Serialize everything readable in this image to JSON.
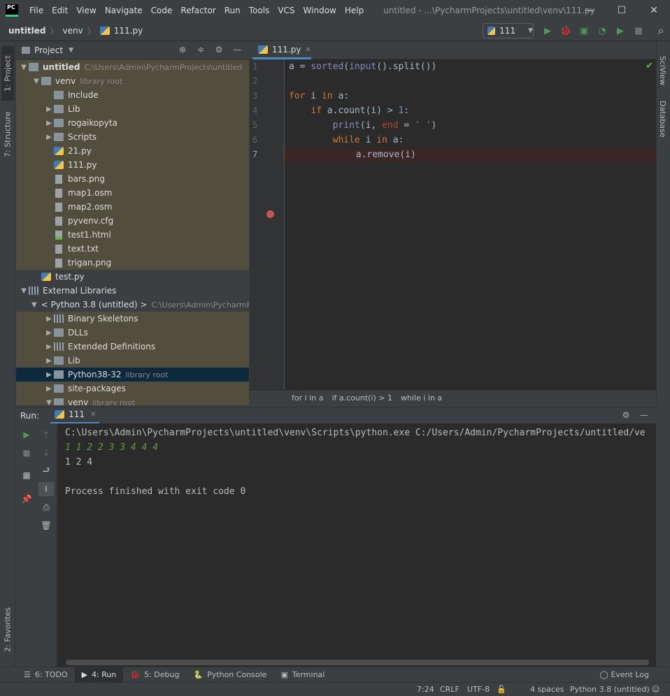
{
  "titlebar": {
    "logo": "PC",
    "menu": [
      "File",
      "Edit",
      "View",
      "Navigate",
      "Code",
      "Refactor",
      "Run",
      "Tools",
      "VCS",
      "Window",
      "Help"
    ],
    "window_title": "untitled - ...\\PycharmProjects\\untitled\\venv\\111.py",
    "minimize": "—",
    "maximize": "☐",
    "close": "✕"
  },
  "navbar": {
    "crumbs": [
      "untitled",
      "venv",
      "111.py"
    ],
    "run_config": "111",
    "tools": {
      "run": "▶",
      "debug": "🐞",
      "coverage": "▣",
      "profile": "◔",
      "concurrency": "▶",
      "stop": "■",
      "search": "⌕"
    }
  },
  "left_strip": {
    "project_tab": "1: Project",
    "structure_tab": "7: Structure",
    "favorites_tab": "2: Favorites"
  },
  "right_strip": {
    "sciview_tab": "SciView",
    "database_tab": "Database"
  },
  "project": {
    "header": "Project",
    "tree": [
      {
        "label": "untitled",
        "path": "C:\\Users\\Admin\\PycharmProjects\\untitled",
        "indent": 0,
        "arrow": "▼",
        "icon": "folder",
        "bold": true,
        "bg": "lib"
      },
      {
        "label": "venv",
        "path": "library root",
        "indent": 1,
        "arrow": "▼",
        "icon": "folder",
        "bg": "lib"
      },
      {
        "label": "Include",
        "indent": 2,
        "arrow": "",
        "icon": "folder",
        "bg": "lib"
      },
      {
        "label": "Lib",
        "indent": 2,
        "arrow": "▶",
        "icon": "folder",
        "bg": "lib"
      },
      {
        "label": "rogaikopyta",
        "indent": 2,
        "arrow": "▶",
        "icon": "folder",
        "bg": "lib"
      },
      {
        "label": "Scripts",
        "indent": 2,
        "arrow": "▶",
        "icon": "folder",
        "bg": "lib"
      },
      {
        "label": "21.py",
        "indent": 2,
        "arrow": "",
        "icon": "py",
        "bg": "lib"
      },
      {
        "label": "111.py",
        "indent": 2,
        "arrow": "",
        "icon": "py",
        "bg": "lib"
      },
      {
        "label": "bars.png",
        "indent": 2,
        "arrow": "",
        "icon": "img",
        "bg": "lib"
      },
      {
        "label": "map1.osm",
        "indent": 2,
        "arrow": "",
        "icon": "file",
        "bg": "lib"
      },
      {
        "label": "map2.osm",
        "indent": 2,
        "arrow": "",
        "icon": "file",
        "bg": "lib"
      },
      {
        "label": "pyvenv.cfg",
        "indent": 2,
        "arrow": "",
        "icon": "file",
        "bg": "lib"
      },
      {
        "label": "test1.html",
        "indent": 2,
        "arrow": "",
        "icon": "html",
        "bg": "lib"
      },
      {
        "label": "text.txt",
        "indent": 2,
        "arrow": "",
        "icon": "file",
        "bg": "lib"
      },
      {
        "label": "trigan.png",
        "indent": 2,
        "arrow": "",
        "icon": "img",
        "bg": "lib"
      },
      {
        "label": "test.py",
        "indent": 1,
        "arrow": "",
        "icon": "py",
        "bg": ""
      },
      {
        "label": "External Libraries",
        "indent": 0,
        "arrow": "▼",
        "icon": "lib",
        "bg": ""
      },
      {
        "label": "< Python 3.8 (untitled) >",
        "path": "C:\\Users\\Admin\\PycharmPr",
        "indent": 1,
        "arrow": "▼",
        "icon": "py",
        "bg": ""
      },
      {
        "label": "Binary Skeletons",
        "indent": 2,
        "arrow": "▶",
        "icon": "lib",
        "bg": "lib"
      },
      {
        "label": "DLLs",
        "indent": 2,
        "arrow": "▶",
        "icon": "folder",
        "bg": "lib"
      },
      {
        "label": "Extended Definitions",
        "indent": 2,
        "arrow": "▶",
        "icon": "lib",
        "bg": "lib"
      },
      {
        "label": "Lib",
        "indent": 2,
        "arrow": "▶",
        "icon": "folder",
        "bg": "lib"
      },
      {
        "label": "Python38-32",
        "path": "library root",
        "indent": 2,
        "arrow": "▶",
        "icon": "folder",
        "bg": "sel"
      },
      {
        "label": "site-packages",
        "indent": 2,
        "arrow": "▶",
        "icon": "folder",
        "bg": "lib"
      },
      {
        "label": "venv",
        "path": "library root",
        "indent": 2,
        "arrow": "▼",
        "icon": "folder",
        "bg": "lib"
      }
    ]
  },
  "editor": {
    "tab": "111.py",
    "line_numbers": [
      "1",
      "2",
      "3",
      "4",
      "5",
      "6",
      "7"
    ],
    "current_line": 7,
    "breakpoint_line": 7,
    "code": [
      "a = sorted(input().split())",
      "",
      "for i in a:",
      "    if a.count(i) > 1:",
      "        print(i, end = ' ')",
      "        while i in a:",
      "            a.remove(i)"
    ],
    "breadcrumbs": [
      "for i in a",
      "if a.count(i) > 1",
      "while i in a"
    ]
  },
  "run": {
    "label": "Run:",
    "tab": "111",
    "console": [
      {
        "text": "C:\\Users\\Admin\\PycharmProjects\\untitled\\venv\\Scripts\\python.exe C:/Users/Admin/PycharmProjects/untitled/ve",
        "kind": "cmd"
      },
      {
        "text": "1 1 2 2 3 3 4 4 4",
        "kind": "in"
      },
      {
        "text": "1 2 4",
        "kind": "out"
      },
      {
        "text": "",
        "kind": "out"
      },
      {
        "text": "Process finished with exit code 0",
        "kind": "out"
      }
    ]
  },
  "bottom_tabs": [
    {
      "icon": "☰",
      "label": "6: TODO"
    },
    {
      "icon": "▶",
      "label": "4: Run",
      "active": true
    },
    {
      "icon": "🐞",
      "label": "5: Debug"
    },
    {
      "icon": "🐍",
      "label": "Python Console"
    },
    {
      "icon": "▣",
      "label": "Terminal"
    }
  ],
  "event_log": "Event Log",
  "status": {
    "position": "7:24",
    "line_sep": "CRLF",
    "encoding": "UTF-8",
    "indent": "4 spaces",
    "interpreter": "Python 3.8 (untitled)"
  },
  "colors": {
    "accent": "#4a88c7",
    "run_green": "#499c54",
    "breakpoint": "#c75450",
    "selection": "#0d293e"
  }
}
